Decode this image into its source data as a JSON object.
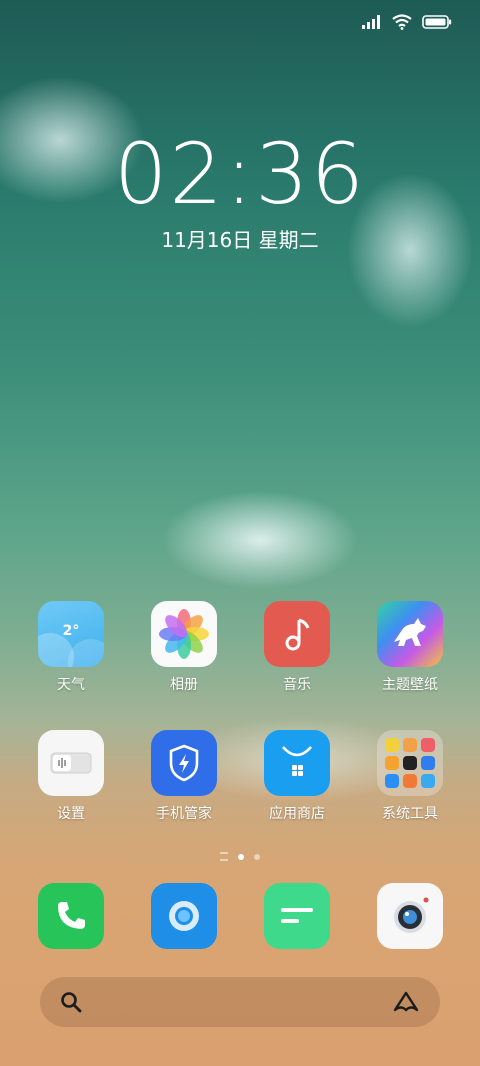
{
  "status_bar": {
    "icons": [
      "signal-icon",
      "wifi-icon",
      "battery-icon"
    ]
  },
  "lockclock": {
    "time": "02:36",
    "date": "11月16日 星期二"
  },
  "home": {
    "row1": [
      {
        "label": "天气",
        "icon": "weather-icon",
        "temp": "2°"
      },
      {
        "label": "相册",
        "icon": "gallery-icon"
      },
      {
        "label": "音乐",
        "icon": "music-icon"
      },
      {
        "label": "主题壁纸",
        "icon": "themes-icon"
      }
    ],
    "row2": [
      {
        "label": "设置",
        "icon": "settings-icon"
      },
      {
        "label": "手机管家",
        "icon": "security-icon"
      },
      {
        "label": "应用商店",
        "icon": "app-store-icon"
      },
      {
        "label": "系统工具",
        "icon": "folder-icon"
      }
    ]
  },
  "page_indicator": {
    "pages": 2,
    "current": 1
  },
  "dock": {
    "apps": [
      "phone-icon",
      "browser-icon",
      "messages-icon",
      "camera-icon"
    ]
  },
  "search_bar": {
    "left_icon": "search-icon",
    "right_icon": "assistant-icon"
  },
  "colors": {
    "music": "#e35a50",
    "security": "#2f6ee8",
    "store": "#1a9ef0",
    "phone": "#27c45a",
    "browser": "#1e8ee6",
    "messages": "#3fd98c"
  }
}
